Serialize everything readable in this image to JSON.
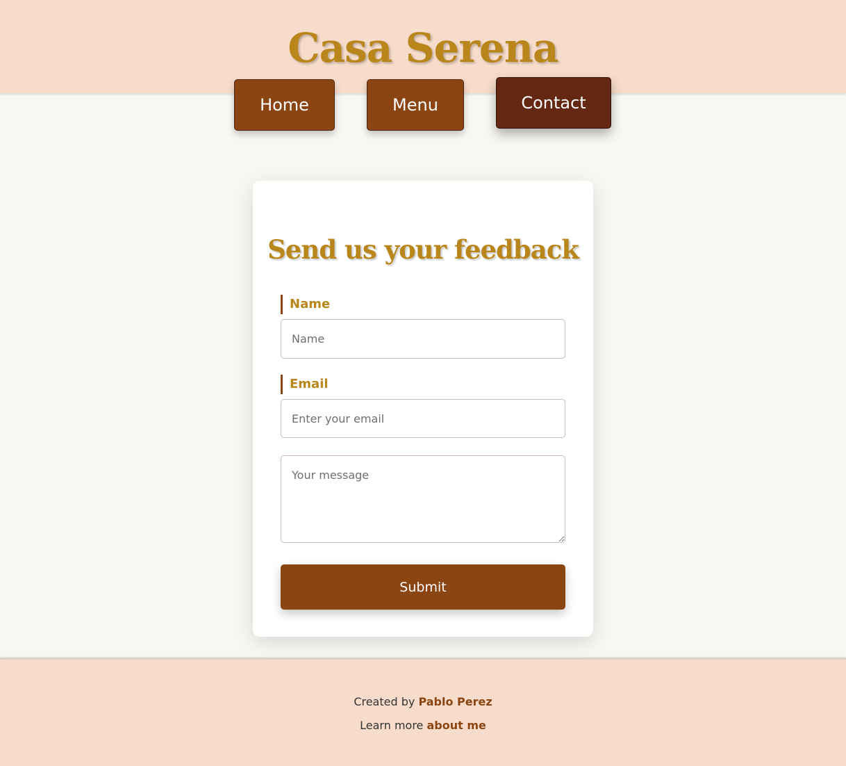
{
  "header": {
    "title": "Casa Serena",
    "nav": [
      {
        "label": "Home"
      },
      {
        "label": "Menu"
      },
      {
        "label": "Contact"
      }
    ]
  },
  "form": {
    "title": "Send us your feedback",
    "name_label": "Name",
    "name_placeholder": "Name",
    "email_label": "Email",
    "email_placeholder": "Enter your email",
    "message_placeholder": "Your message",
    "submit_label": "Submit"
  },
  "footer": {
    "created_prefix": "Created by",
    "author": "Pablo Perez",
    "learn_prefix": "Learn more",
    "about_link": "about me"
  },
  "colors": {
    "header_bg": "#f7dccb",
    "title_gold": "#b8861a",
    "button_brown": "#8b4513",
    "active_nav": "#632712",
    "page_bg": "#f9f7f2"
  }
}
